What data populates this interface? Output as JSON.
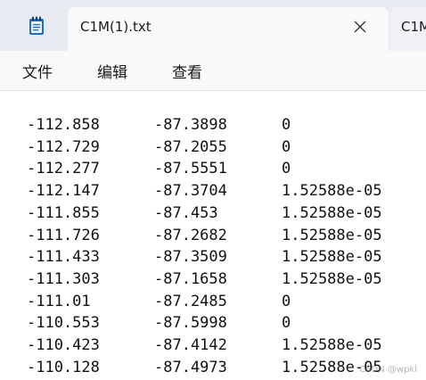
{
  "app": {
    "icon": "notepad-icon",
    "accent": "#0f6cbd"
  },
  "tabs": [
    {
      "title": "C1M(1).txt",
      "active": true
    },
    {
      "title": "C1M",
      "active": false
    }
  ],
  "menu": {
    "file": "文件",
    "edit": "编辑",
    "view": "查看"
  },
  "content": {
    "rows": [
      [
        "-112.858",
        "-87.3898",
        "0"
      ],
      [
        "-112.729",
        "-87.2055",
        "0"
      ],
      [
        "-112.277",
        "-87.5551",
        "0"
      ],
      [
        "-112.147",
        "-87.3704",
        "1.52588e-05"
      ],
      [
        "-111.855",
        "-87.453",
        "1.52588e-05"
      ],
      [
        "-111.726",
        "-87.2682",
        "1.52588e-05"
      ],
      [
        "-111.433",
        "-87.3509",
        "1.52588e-05"
      ],
      [
        "-111.303",
        "-87.1658",
        "1.52588e-05"
      ],
      [
        "-111.01",
        "-87.2485",
        "0"
      ],
      [
        "-110.553",
        "-87.5998",
        "0"
      ],
      [
        "-110.423",
        "-87.4142",
        "1.52588e-05"
      ],
      [
        "-110.128",
        "-87.4973",
        "1.52588e-05"
      ]
    ]
  },
  "watermark": "CSDN @wpkl"
}
